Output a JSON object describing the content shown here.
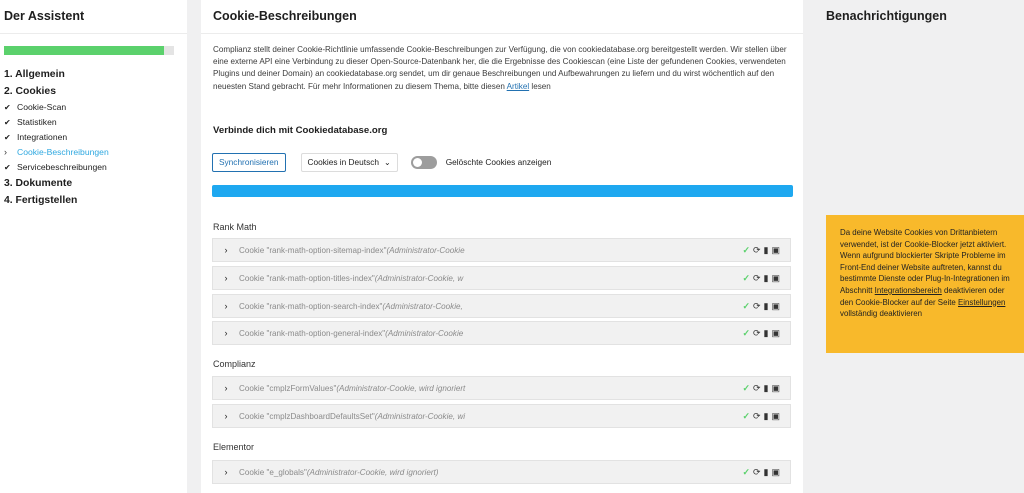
{
  "left": {
    "title": "Der Assistent",
    "progress": 0.94,
    "steps": [
      {
        "label": "1. Allgemein"
      },
      {
        "label": "2. Cookies"
      }
    ],
    "subs": [
      {
        "label": "Cookie-Scan"
      },
      {
        "label": "Statistiken"
      },
      {
        "label": "Integrationen"
      },
      {
        "label": "Cookie-Beschreibungen"
      },
      {
        "label": "Servicebeschreibungen"
      }
    ],
    "steps2": [
      {
        "label": "3. Dokumente"
      },
      {
        "label": "4. Fertigstellen"
      }
    ]
  },
  "main": {
    "title": "Cookie-Beschreibungen",
    "intro": "Complianz stellt deiner Cookie-Richtlinie umfassende Cookie-Beschreibungen zur Verfügung, die von cookiedatabase.org bereitgestellt werden. Wir stellen über eine externe API eine Verbindung zu dieser Open-Source-Datenbank her, die die Ergebnisse des Cookiescan (eine Liste der gefundenen Cookies, verwendeten Plugins und deiner Domain) an cookiedatabase.org sendet, um dir genaue Beschreibungen und Aufbewahrungen zu liefern und du wirst wöchentlich auf den neuesten Stand gebracht. Für mehr Informationen zu diesem Thema, bitte diesen",
    "intro_link": "Artikel",
    "intro_end": " lesen",
    "subhead": "Verbinde dich mit Cookiedatabase.org",
    "sync_label": "Synchronisieren",
    "language": "Cookies in Deutsch",
    "toggle_label": "Gelöschte Cookies anzeigen",
    "groups": [
      {
        "name": "Rank Math"
      },
      {
        "name": "Complianz"
      },
      {
        "name": "Elementor"
      }
    ],
    "cookies": [
      {
        "name": "Cookie \"rank-math-option-sitemap-index\"",
        "note": "(Administrator-Cookie"
      },
      {
        "name": "Cookie \"rank-math-option-titles-index\"",
        "note": "(Administrator-Cookie, w"
      },
      {
        "name": "Cookie \"rank-math-option-search-index\"",
        "note": "(Administrator-Cookie,"
      },
      {
        "name": "Cookie \"rank-math-option-general-index\"",
        "note": "(Administrator-Cookie"
      },
      {
        "name": "Cookie \"cmplzFormValues\"",
        "note": "(Administrator-Cookie, wird ignoriert"
      },
      {
        "name": "Cookie \"cmplzDashboardDefaultsSet\"",
        "note": "(Administrator-Cookie, wi"
      },
      {
        "name": "Cookie \"e_globals\"",
        "note": "(Administrator-Cookie, wird ignoriert)"
      }
    ]
  },
  "right": {
    "title": "Benachrichtigungen",
    "notice_a": "Da deine Website Cookies von Drittanbietern verwendet, ist der Cookie-Blocker jetzt aktiviert. Wenn aufgrund blockierter Skripte Probleme im Front-End deiner Website auftreten, kannst du bestimmte Dienste oder Plug-In-Integrationen im Abschnitt",
    "notice_link1": "Integrationsbereich",
    "notice_b": " deaktivieren oder den Cookie-Blocker auf der Seite",
    "notice_link2": "Einstellungen",
    "notice_c": " vollständig deaktivieren"
  },
  "colors": {
    "accent": "#2271b1",
    "progress": "#5bd16c",
    "bar": "#1ea8f0",
    "notice": "#f8b92b"
  }
}
